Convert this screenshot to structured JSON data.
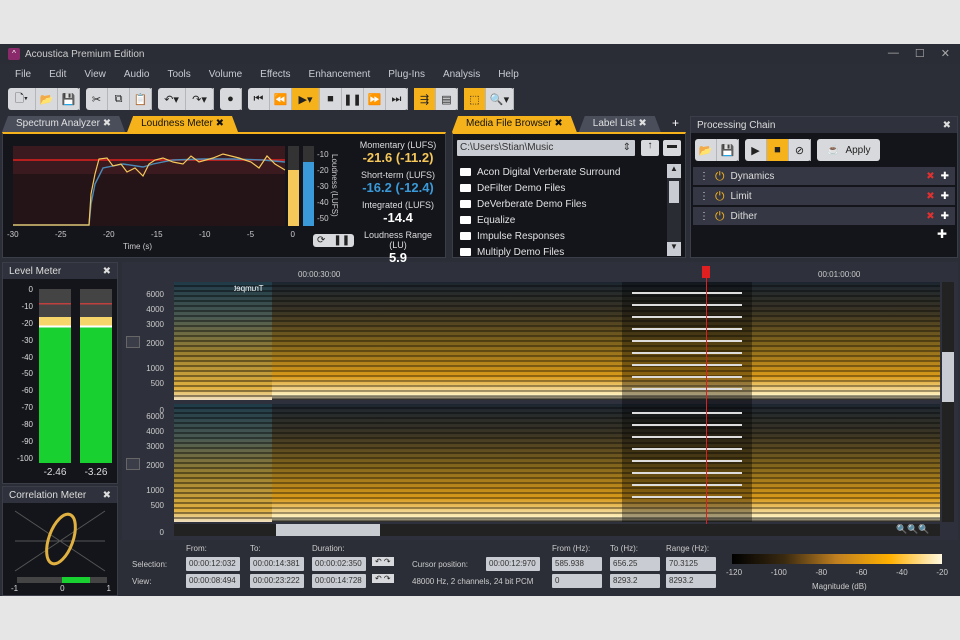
{
  "app": {
    "title": "Acoustica Premium Edition"
  },
  "menu": [
    "File",
    "Edit",
    "View",
    "Audio",
    "Tools",
    "Volume",
    "Effects",
    "Enhancement",
    "Plug-Ins",
    "Analysis",
    "Help"
  ],
  "left_tabs": [
    {
      "label": "Spectrum Analyzer",
      "active": false
    },
    {
      "label": "Loudness Meter",
      "active": true
    }
  ],
  "loudness": {
    "x_ticks": [
      "-30",
      "-25",
      "-20",
      "-15",
      "-10",
      "-5",
      "0"
    ],
    "x_label": "Time (s)",
    "y_ticks": [
      "-10",
      "-20",
      "-30",
      "-40",
      "-50"
    ],
    "y_label": "Loudness (LUFS)",
    "momentary_label": "Momentary (LUFS)",
    "momentary": "-21.6 (-11.2)",
    "shortterm_label": "Short-term (LUFS)",
    "shortterm": "-16.2 (-12.4)",
    "integrated_label": "Integrated (LUFS)",
    "integrated": "-14.4",
    "range_label": "Loudness Range (LU)",
    "range": "5.9",
    "momentary_color": "#f6c85a",
    "shortterm_color": "#3a9ad9"
  },
  "mid_tabs": [
    {
      "label": "Media File Browser",
      "active": true
    },
    {
      "label": "Label List",
      "active": false
    }
  ],
  "browser": {
    "path": "C:\\Users\\Stian\\Music",
    "files": [
      "Acon Digital Verberate Surround",
      "DeFilter Demo Files",
      "DeVerberate Demo Files",
      "Equalize",
      "Impulse Responses",
      "Multiply Demo Files"
    ]
  },
  "chain": {
    "title": "Processing Chain",
    "apply": "Apply",
    "items": [
      "Dynamics",
      "Limit",
      "Dither"
    ]
  },
  "level_meter": {
    "title": "Level Meter",
    "ticks": [
      "0",
      "-10",
      "-20",
      "-30",
      "-40",
      "-50",
      "-60",
      "-70",
      "-80",
      "-90",
      "-100"
    ],
    "left": "-2.46",
    "right": "-3.26",
    "fill_db": -16
  },
  "correlation": {
    "title": "Correlation Meter",
    "ticks": [
      "-1",
      "0",
      "1"
    ]
  },
  "spectrogram": {
    "time_marks": [
      "00:00:30:00",
      "00:01:00:00"
    ],
    "freq_ticks": [
      "6000",
      "4000",
      "3000",
      "2000",
      "1000",
      "500",
      "0"
    ],
    "label_text": "Trumpet"
  },
  "info": {
    "from": "From:",
    "to": "To:",
    "duration": "Duration:",
    "selection_label": "Selection:",
    "view_label": "View:",
    "selection": [
      "00:00:12:032",
      "00:00:14:381",
      "00:00:02:350"
    ],
    "view": [
      "00:00:08:494",
      "00:00:23:222",
      "00:00:14:728"
    ],
    "cursor_label": "Cursor position:",
    "cursor": "00:00:12:970",
    "format": "48000 Hz, 2 channels, 24 bit PCM",
    "from_hz": "From (Hz):",
    "to_hz": "To (Hz):",
    "range_hz": "Range (Hz):",
    "sel_hz": [
      "585.938",
      "656.25",
      "70.3125"
    ],
    "view_hz": [
      "0",
      "8293.2",
      "8293.2"
    ],
    "mag_ticks": [
      "-120",
      "-100",
      "-80",
      "-60",
      "-40",
      "-20"
    ],
    "mag_label": "Magnitude (dB)"
  }
}
